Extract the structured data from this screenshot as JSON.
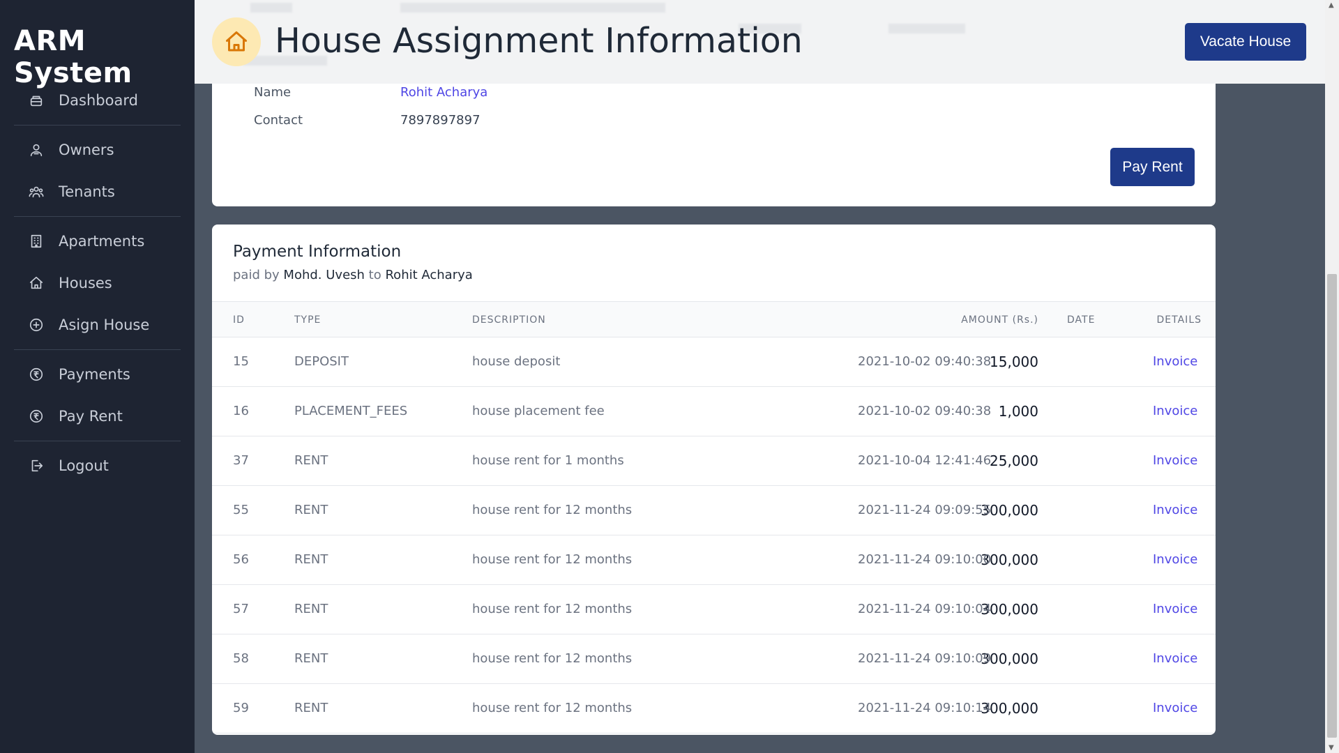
{
  "app": {
    "brand": "ARM System"
  },
  "sidebar": {
    "items": [
      {
        "label": "Dashboard",
        "icon": "dashboard-icon"
      },
      {
        "label": "Owners",
        "icon": "owners-icon"
      },
      {
        "label": "Tenants",
        "icon": "tenants-icon"
      },
      {
        "label": "Apartments",
        "icon": "building-icon"
      },
      {
        "label": "Houses",
        "icon": "home-icon"
      },
      {
        "label": "Asign House",
        "icon": "plus-circle-icon"
      },
      {
        "label": "Payments",
        "icon": "rupee-icon"
      },
      {
        "label": "Pay Rent",
        "icon": "rupee-icon"
      },
      {
        "label": "Logout",
        "icon": "logout-icon"
      }
    ]
  },
  "header": {
    "title": "House Assignment Information",
    "vacate_label": "Vacate House"
  },
  "tenant_card": {
    "name_label": "Name",
    "name_value": "Rohit Acharya",
    "contact_label": "Contact",
    "contact_value": "7897897897",
    "pay_rent_label": "Pay Rent"
  },
  "payment": {
    "title": "Payment Information",
    "sub_prefix": "paid by",
    "payer": "Mohd. Uvesh",
    "sub_mid": "to",
    "payee": "Rohit Acharya",
    "columns": {
      "id": "ID",
      "type": "TYPE",
      "description": "DESCRIPTION",
      "amount": "AMOUNT (Rs.)",
      "date": "DATE",
      "details": "DETAILS"
    },
    "rows": [
      {
        "id": "15",
        "type": "DEPOSIT",
        "description": "house deposit",
        "amount": "15,000",
        "date": "2021-10-02 09:40:38",
        "details": "Invoice"
      },
      {
        "id": "16",
        "type": "PLACEMENT_FEES",
        "description": "house placement fee",
        "amount": "1,000",
        "date": "2021-10-02 09:40:38",
        "details": "Invoice"
      },
      {
        "id": "37",
        "type": "RENT",
        "description": "house rent for 1 months",
        "amount": "25,000",
        "date": "2021-10-04 12:41:46",
        "details": "Invoice"
      },
      {
        "id": "55",
        "type": "RENT",
        "description": "house rent for 12 months",
        "amount": "300,000",
        "date": "2021-11-24 09:09:55",
        "details": "Invoice"
      },
      {
        "id": "56",
        "type": "RENT",
        "description": "house rent for 12 months",
        "amount": "300,000",
        "date": "2021-11-24 09:10:00",
        "details": "Invoice"
      },
      {
        "id": "57",
        "type": "RENT",
        "description": "house rent for 12 months",
        "amount": "300,000",
        "date": "2021-11-24 09:10:04",
        "details": "Invoice"
      },
      {
        "id": "58",
        "type": "RENT",
        "description": "house rent for 12 months",
        "amount": "300,000",
        "date": "2021-11-24 09:10:09",
        "details": "Invoice"
      },
      {
        "id": "59",
        "type": "RENT",
        "description": "house rent for 12 months",
        "amount": "300,000",
        "date": "2021-11-24 09:10:14",
        "details": "Invoice"
      }
    ]
  },
  "colors": {
    "sidebar_bg": "#1e2432",
    "accent_button": "#1e3a8a",
    "link": "#4f46e5",
    "page_bg": "#4b5563",
    "home_badge_bg": "#fde9b3",
    "home_badge_icon": "#d97706"
  }
}
